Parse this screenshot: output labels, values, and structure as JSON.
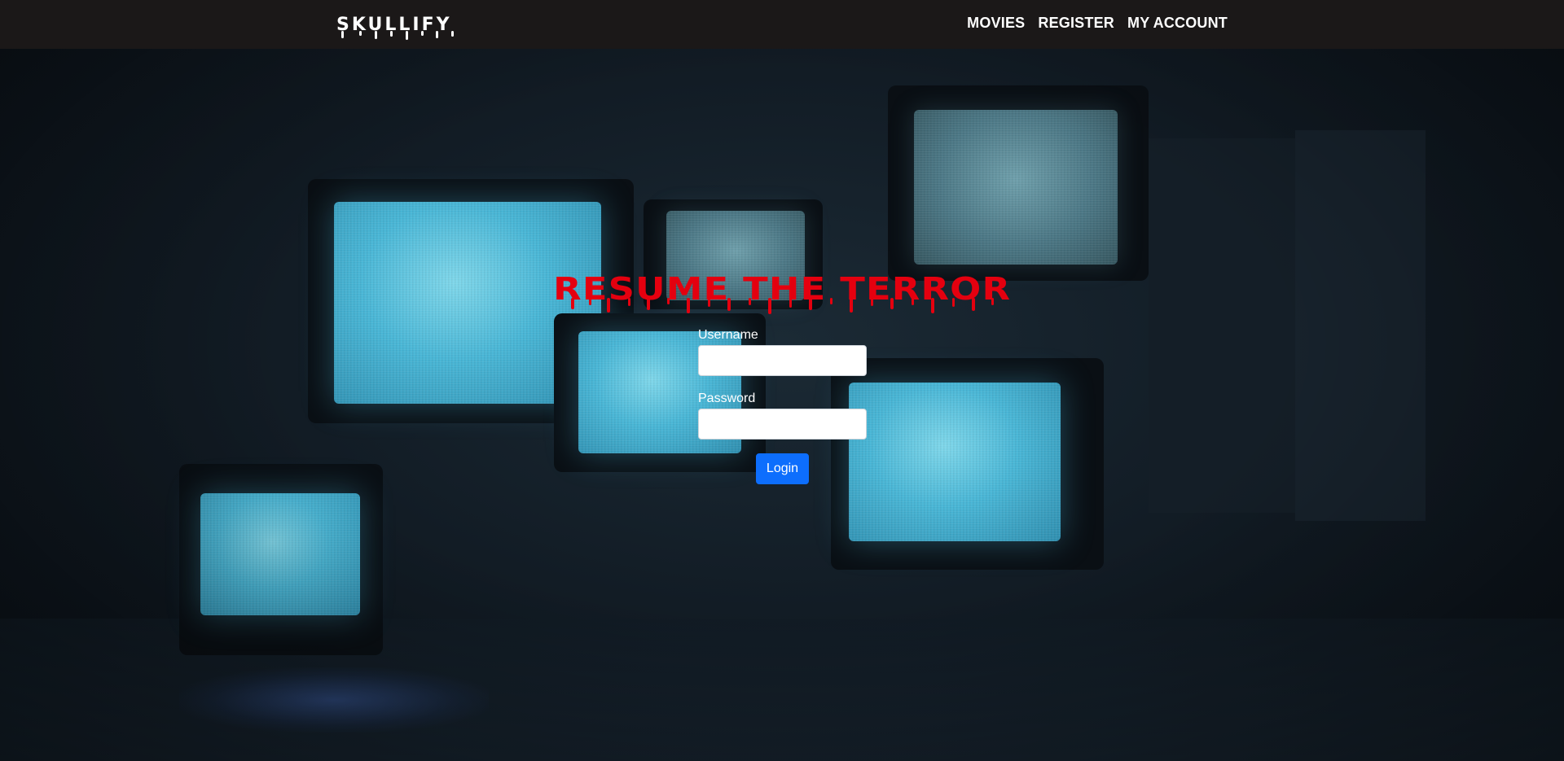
{
  "navbar": {
    "brand": "SKULLIFY",
    "links": [
      {
        "label": "MOVIES"
      },
      {
        "label": "REGISTER"
      },
      {
        "label": "MY ACCOUNT"
      }
    ]
  },
  "login": {
    "heading": "RESUME THE TERROR",
    "username_label": "Username",
    "username_value": "",
    "password_label": "Password",
    "password_value": "",
    "submit_label": "Login"
  },
  "colors": {
    "navbar_bg": "#1b1818",
    "heading_red": "#e4000f",
    "button_blue": "#0d6efd"
  },
  "icons": {
    "brand_drips": "dripping-letters",
    "heading_drips": "blood-drips"
  }
}
